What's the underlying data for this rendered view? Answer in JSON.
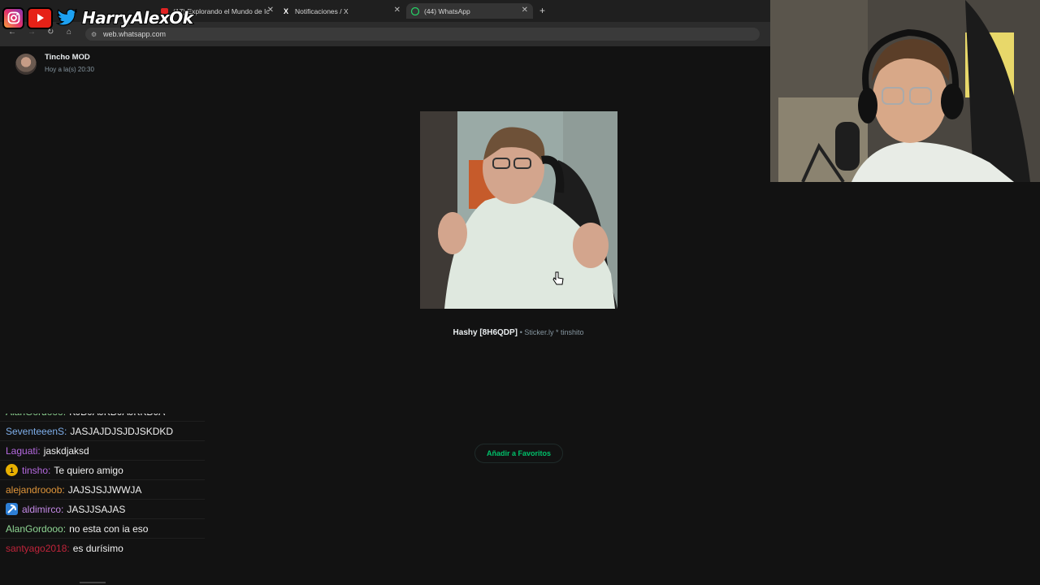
{
  "social": {
    "handle": "HarryAlexOk"
  },
  "browser": {
    "tabs": [
      {
        "label": "(17) Explorando el Mundo de Ic",
        "icon": "youtube-icon"
      },
      {
        "label": "Notificaciones / X",
        "icon": "x-icon"
      },
      {
        "label": "(44) WhatsApp",
        "icon": "whatsapp-icon",
        "active": true
      }
    ],
    "url": "web.whatsapp.com"
  },
  "viewer": {
    "sender_name": "Tincho MOD",
    "sent_time": "Hoy a la(s) 20:30",
    "sticker_name": "Hashy [8H6QDP]",
    "sticker_meta": "• Sticker.ly * tinshito",
    "favorite_button": "Añadir a Favoritos"
  },
  "chat": {
    "messages": [
      {
        "user": "AlanGordooo:",
        "text": "KJDJAJKDJAJKKDJA",
        "color": "#8fd694"
      },
      {
        "user": "SeventeeenS:",
        "text": "JASJAJDJSJDJSKDKD",
        "color": "#7eaeea"
      },
      {
        "user": "Laguati:",
        "text": "jaskdjaksd",
        "color": "#b569e0"
      },
      {
        "user": "tinsho:",
        "text": "Te quiero amigo",
        "color": "#b569e0",
        "badge": "1"
      },
      {
        "user": "alejandrooob:",
        "text": "JAJSJSJJWWJA",
        "color": "#e0953a"
      },
      {
        "user": "aldimirco:",
        "text": "JASJJSAJAS",
        "color": "#c58ae8",
        "badge": "pick"
      },
      {
        "user": "AlanGordooo:",
        "text": "no esta con ia eso",
        "color": "#8fd694"
      },
      {
        "user": "santyago2018:",
        "text": "es durísimo",
        "color": "#c0243a"
      }
    ]
  },
  "colors": {
    "accent_green": "#00c06a",
    "background": "#121212"
  }
}
